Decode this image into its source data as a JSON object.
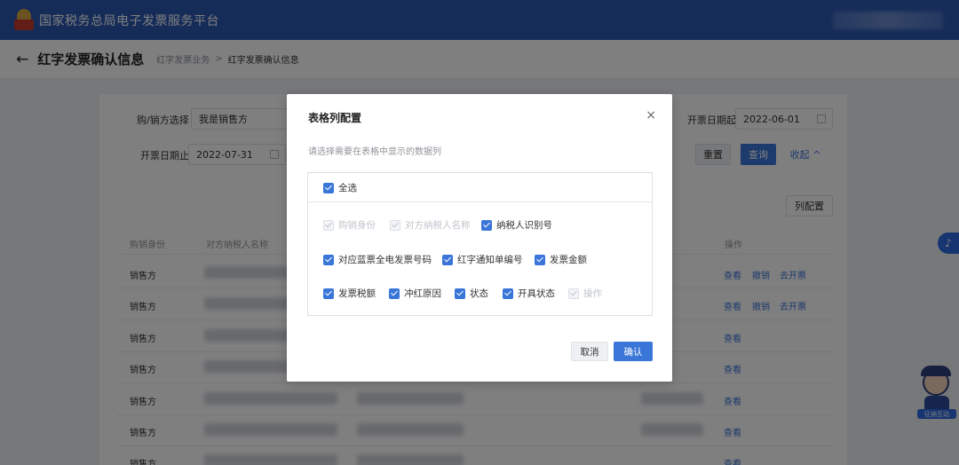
{
  "header": {
    "app_title": "国家税务总局电子发票服务平台"
  },
  "subheader": {
    "back_icon": "←",
    "page_title": "红字发票确认信息",
    "breadcrumb": [
      "红字发票业务",
      "红字发票确认信息"
    ],
    "breadcrumb_sep": ">"
  },
  "filters": {
    "role_label": "购/销方选择",
    "role_value": "我是销售方",
    "start_label": "开票日期起",
    "start_value": "2022-06-01",
    "end_label": "开票日期止",
    "end_value": "2022-07-31",
    "reset_label": "重置",
    "query_label": "查询",
    "collapse_label": "收起 ^",
    "column_config_label": "列配置"
  },
  "table": {
    "headers": [
      "购销身份",
      "对方纳税人名称",
      "操作"
    ],
    "rows": [
      {
        "role": "销售方",
        "actions": [
          "查看",
          "撤销",
          "去开票"
        ]
      },
      {
        "role": "销售方",
        "actions": [
          "查看",
          "撤销",
          "去开票"
        ]
      },
      {
        "role": "销售方",
        "actions": [
          "查看"
        ]
      },
      {
        "role": "销售方",
        "actions": [
          "查看"
        ]
      },
      {
        "role": "销售方",
        "actions": [
          "查看"
        ]
      },
      {
        "role": "销售方",
        "actions": [
          "查看"
        ]
      },
      {
        "role": "销售方",
        "actions": [
          "查看"
        ]
      }
    ]
  },
  "modal": {
    "title": "表格列配置",
    "close_icon": "×",
    "hint": "请选择需要在表格中显示的数据列",
    "select_all": "全选",
    "options": [
      {
        "label": "购销身份",
        "checked": true,
        "disabled": true
      },
      {
        "label": "对方纳税人名称",
        "checked": true,
        "disabled": true
      },
      {
        "label": "纳税人识别号",
        "checked": true,
        "disabled": false
      },
      {
        "label": "对应蓝票全电发票号码",
        "checked": true,
        "disabled": false
      },
      {
        "label": "红字通知单编号",
        "checked": true,
        "disabled": false
      },
      {
        "label": "发票金额",
        "checked": true,
        "disabled": false
      },
      {
        "label": "发票税额",
        "checked": true,
        "disabled": false
      },
      {
        "label": "冲红原因",
        "checked": true,
        "disabled": false
      },
      {
        "label": "状态",
        "checked": true,
        "disabled": false
      },
      {
        "label": "开具状态",
        "checked": true,
        "disabled": false
      },
      {
        "label": "操作",
        "checked": true,
        "disabled": true
      }
    ],
    "cancel_label": "取消",
    "confirm_label": "确认"
  },
  "assistant": {
    "label": "征纳互动",
    "help_icon": "headset-icon"
  },
  "colors": {
    "primary": "#2b58b2",
    "accent": "#3a76d8",
    "link": "#3a73d6"
  }
}
